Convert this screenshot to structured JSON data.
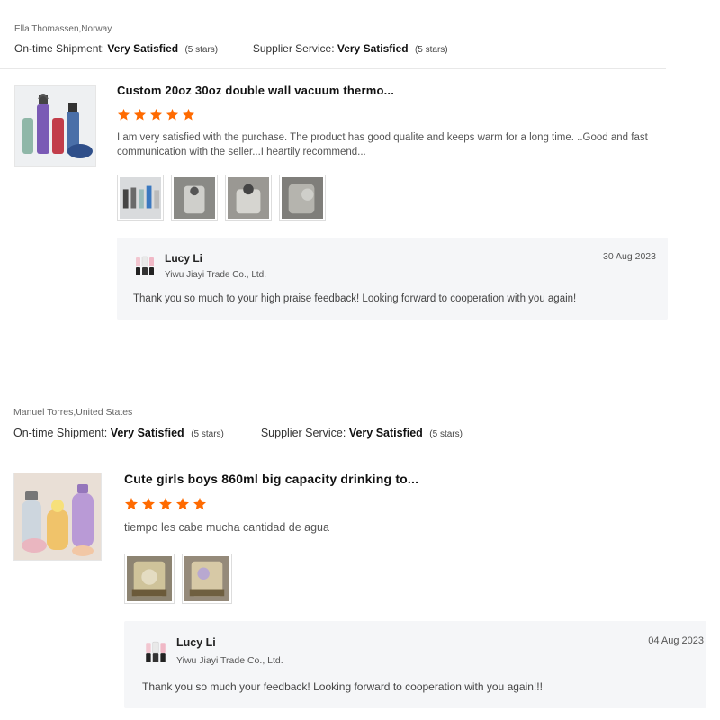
{
  "reviews": [
    {
      "reviewer": "Ella Thomassen,Norway",
      "shipment_label": "On-time Shipment:",
      "shipment_value": "Very Satisfied",
      "shipment_stars": "(5 stars)",
      "service_label": "Supplier Service:",
      "service_value": "Very Satisfied",
      "service_stars": "(5 stars)",
      "product_title": "Custom 20oz 30oz double wall vacuum thermo...",
      "rating": 5,
      "comment": "I am very satisfied with the purchase. The product has good qualite and keeps warm for a long time. ..Good and fast communication with the seller...I heartily recommend...",
      "reply": {
        "name": "Lucy Li",
        "company": "Yiwu Jiayi Trade Co., Ltd.",
        "date": "30 Aug 2023",
        "text": "Thank you so much to your high praise feedback!  Looking forward to cooperation with you again!"
      }
    },
    {
      "reviewer": "Manuel Torres,United States",
      "shipment_label": "On-time Shipment:",
      "shipment_value": "Very Satisfied",
      "shipment_stars": "(5 stars)",
      "service_label": "Supplier Service:",
      "service_value": "Very Satisfied",
      "service_stars": "(5 stars)",
      "product_title": "Cute girls boys 860ml big capacity drinking to...",
      "rating": 5,
      "comment": "tiempo les cabe mucha cantidad de agua",
      "reply": {
        "name": "Lucy Li",
        "company": "Yiwu Jiayi Trade Co., Ltd.",
        "date": "04 Aug 2023",
        "text": "Thank you so much your feedback! Looking forward to cooperation with you again!!!"
      }
    }
  ],
  "colors": {
    "star": "#ff6a00",
    "reply_bg": "#f5f6f8",
    "divider": "#e8e8e8"
  }
}
